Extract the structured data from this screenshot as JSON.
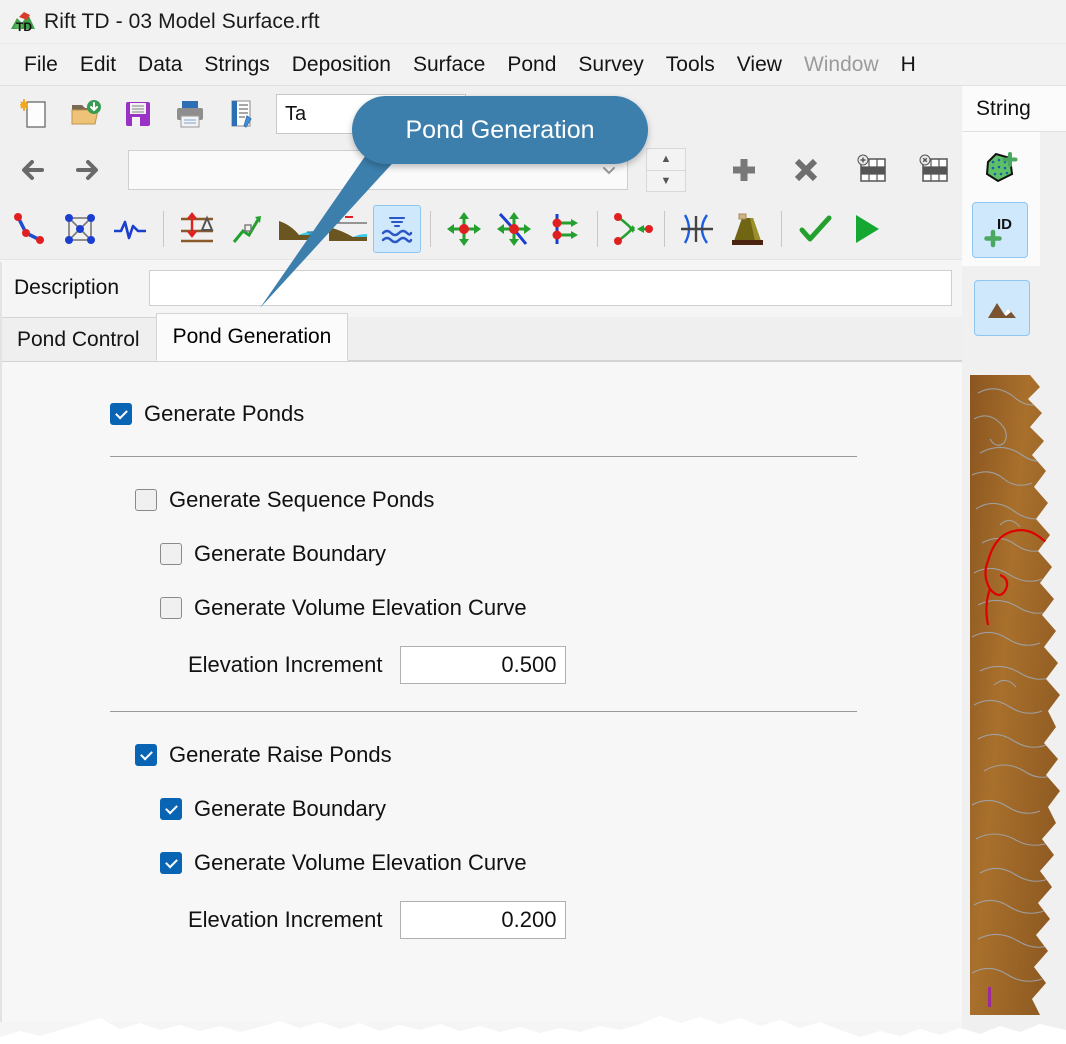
{
  "window": {
    "title": "Rift TD - 03 Model Surface.rft",
    "icon": "app-terrain-td-icon"
  },
  "menubar": {
    "items": [
      {
        "label": "File",
        "disabled": false
      },
      {
        "label": "Edit",
        "disabled": false
      },
      {
        "label": "Data",
        "disabled": false
      },
      {
        "label": "Strings",
        "disabled": false
      },
      {
        "label": "Deposition",
        "disabled": false
      },
      {
        "label": "Surface",
        "disabled": false
      },
      {
        "label": "Pond",
        "disabled": false
      },
      {
        "label": "Survey",
        "disabled": false
      },
      {
        "label": "Tools",
        "disabled": false
      },
      {
        "label": "View",
        "disabled": false
      },
      {
        "label": "Window",
        "disabled": true
      },
      {
        "label": "H",
        "disabled": false
      }
    ]
  },
  "toolbar": {
    "row1": {
      "icons": [
        "new-document-icon",
        "open-folder-icon",
        "save-floppy-icon",
        "print-icon",
        "edit-document-icon"
      ],
      "table_field_value": "Ta",
      "check_icon": "green-check-circle-icon",
      "toggle_state": "on"
    },
    "row2": {
      "back_label": "back-arrow-icon",
      "forward_label": "forward-arrow-icon",
      "combo_value": "",
      "icons": [
        "spinner-updown",
        "add-plus-icon",
        "delete-x-icon",
        "add-row-table-icon",
        "delete-row-table-icon"
      ]
    },
    "row3": {
      "icons": [
        "polyline-icon",
        "node-graph-icon",
        "waveform-icon",
        "elevation-delta-icon",
        "slope-arrow-icon",
        "pond-section-icon",
        "pond-profile-icon",
        "pond-generation-icon",
        "move-point-icon",
        "move-curve-icon",
        "offset-points-icon",
        "merge-points-icon",
        "intersect-icon",
        "embankment-icon",
        "apply-check-icon",
        "run-play-icon"
      ],
      "selected_icon": "pond-generation-icon"
    }
  },
  "callout": {
    "text": "Pond Generation",
    "color": "#3c7fad"
  },
  "description": {
    "label": "Description",
    "value": "",
    "placeholder": ""
  },
  "tabs": [
    {
      "label": "Pond Control",
      "active": false
    },
    {
      "label": "Pond Generation",
      "active": true
    }
  ],
  "form": {
    "generate_ponds": {
      "label": "Generate Ponds",
      "checked": true
    },
    "sequence": {
      "title": {
        "label": "Generate Sequence Ponds",
        "checked": false
      },
      "boundary": {
        "label": "Generate Boundary",
        "checked": false
      },
      "curve": {
        "label": "Generate Volume Elevation Curve",
        "checked": false
      },
      "increment": {
        "label": "Elevation Increment",
        "value": "0.500"
      }
    },
    "raise": {
      "title": {
        "label": "Generate Raise Ponds",
        "checked": true
      },
      "boundary": {
        "label": "Generate Boundary",
        "checked": true
      },
      "curve": {
        "label": "Generate Volume Elevation Curve",
        "checked": true
      },
      "increment": {
        "label": "Elevation Increment",
        "value": "0.200"
      }
    }
  },
  "right_panel": {
    "tab_label": "String",
    "tools": [
      "add-polygon-icon",
      "add-id-icon"
    ],
    "selected_tool": "add-id-icon",
    "view_tool": "terrain-mountain-icon"
  },
  "colors": {
    "accent_checkbox": "#0a64b4",
    "callout_blue": "#3c7fad",
    "selection_blue": "#cfe8fb",
    "toggle_green": "#4caf50",
    "terrain_brown": "#a0662a"
  }
}
